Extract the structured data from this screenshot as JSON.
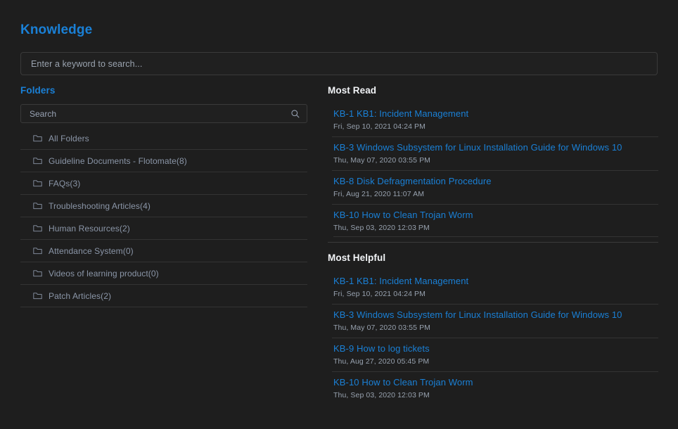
{
  "header": {
    "title": "Knowledge"
  },
  "keyword_search": {
    "placeholder": "Enter a keyword to search...",
    "value": ""
  },
  "folders_panel": {
    "heading": "Folders",
    "search": {
      "placeholder": "Search",
      "value": "",
      "icon": "search-icon"
    },
    "items": [
      {
        "label": "All Folders",
        "icon": "folder-icon"
      },
      {
        "label": "Guideline Documents - Flotomate(8)",
        "icon": "folder-icon"
      },
      {
        "label": "FAQs(3)",
        "icon": "folder-icon"
      },
      {
        "label": "Troubleshooting Articles(4)",
        "icon": "folder-icon"
      },
      {
        "label": "Human Resources(2)",
        "icon": "folder-icon"
      },
      {
        "label": "Attendance System(0)",
        "icon": "folder-icon"
      },
      {
        "label": "Videos of learning product(0)",
        "icon": "folder-icon"
      },
      {
        "label": "Patch Articles(2)",
        "icon": "folder-icon"
      }
    ]
  },
  "most_read": {
    "heading": "Most Read",
    "articles": [
      {
        "title": "KB-1 KB1: Incident Management",
        "date": "Fri, Sep 10, 2021 04:24 PM"
      },
      {
        "title": "KB-3 Windows Subsystem for Linux Installation Guide for Windows 10",
        "date": "Thu, May 07, 2020 03:55 PM"
      },
      {
        "title": "KB-8 Disk Defragmentation Procedure",
        "date": "Fri, Aug 21, 2020 11:07 AM"
      },
      {
        "title": "KB-10 How to Clean Trojan Worm",
        "date": "Thu, Sep 03, 2020 12:03 PM"
      }
    ]
  },
  "most_helpful": {
    "heading": "Most Helpful",
    "articles": [
      {
        "title": "KB-1 KB1: Incident Management",
        "date": "Fri, Sep 10, 2021 04:24 PM"
      },
      {
        "title": "KB-3 Windows Subsystem for Linux Installation Guide for Windows 10",
        "date": "Thu, May 07, 2020 03:55 PM"
      },
      {
        "title": "KB-9 How to log tickets",
        "date": "Thu, Aug 27, 2020 05:45 PM"
      },
      {
        "title": "KB-10 How to Clean Trojan Worm",
        "date": "Thu, Sep 03, 2020 12:03 PM"
      }
    ]
  },
  "colors": {
    "background": "#1e1e1e",
    "accent_blue": "#1a80d6",
    "heading_white": "#f2f4f7",
    "muted_text": "#97a1ae",
    "folder_text": "#8b96a8",
    "divider": "#333333"
  }
}
